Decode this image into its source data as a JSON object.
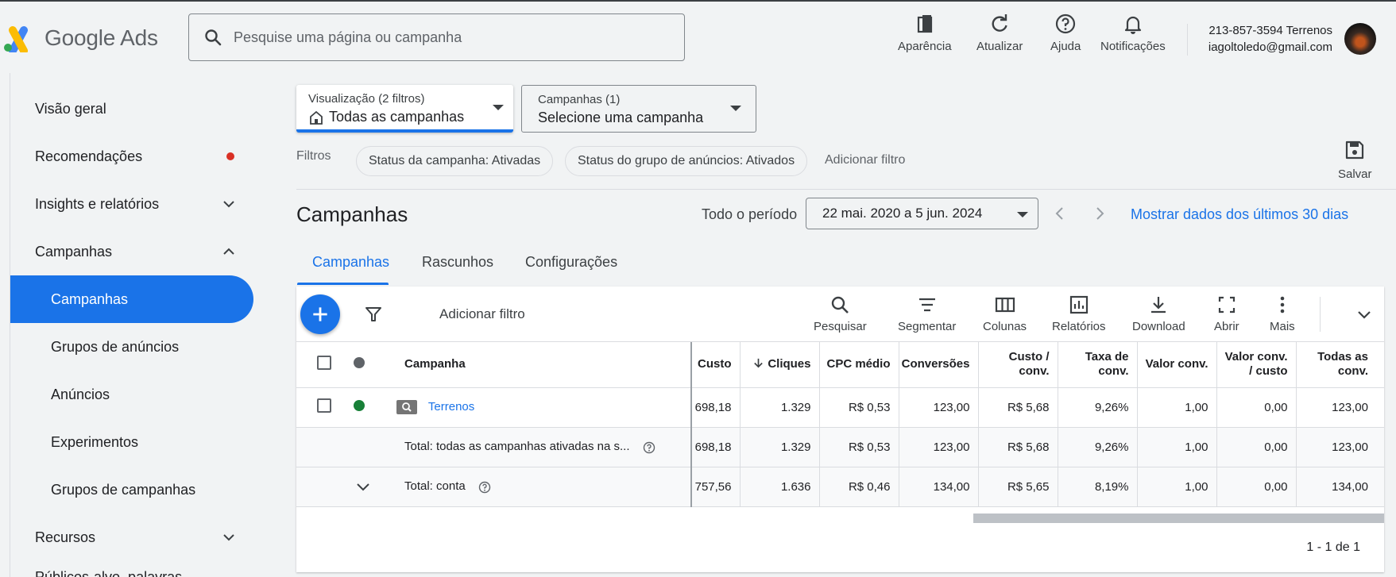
{
  "header": {
    "brand": "Google Ads",
    "search_placeholder": "Pesquise uma página ou campanha",
    "buttons": [
      {
        "label": "Aparência",
        "icon": "appearance-icon"
      },
      {
        "label": "Atualizar",
        "icon": "refresh-icon"
      },
      {
        "label": "Ajuda",
        "icon": "help-icon"
      },
      {
        "label": "Notificações",
        "icon": "bell-icon"
      }
    ],
    "account_line1": "213-857-3594 Terrenos",
    "account_line2": "iagoltoledo@gmail.com"
  },
  "sidebar": {
    "items": [
      {
        "label": "Visão geral"
      },
      {
        "label": "Recomendações"
      },
      {
        "label": "Insights e relatórios"
      },
      {
        "label": "Campanhas"
      },
      {
        "label": "Campanhas"
      },
      {
        "label": "Grupos de anúncios"
      },
      {
        "label": "Anúncios"
      },
      {
        "label": "Experimentos"
      },
      {
        "label": "Grupos de campanhas"
      },
      {
        "label": "Recursos"
      },
      {
        "label": "Públicos-alvo, palavras-"
      }
    ]
  },
  "view_select": {
    "small": "Visualização (2 filtros)",
    "value": "Todas as campanhas"
  },
  "campaign_select": {
    "small": "Campanhas (1)",
    "value": "Selecione uma campanha"
  },
  "filters": {
    "label": "Filtros",
    "chips": [
      "Status da campanha: Ativadas",
      "Status do grupo de anúncios: Ativados"
    ],
    "add": "Adicionar filtro",
    "save": "Salvar"
  },
  "page": {
    "title": "Campanhas",
    "period_label": "Todo o período",
    "date_range": "22 mai. 2020 a 5 jun. 2024",
    "last30": "Mostrar dados dos últimos 30 dias"
  },
  "tabs": [
    "Campanhas",
    "Rascunhos",
    "Configurações"
  ],
  "toolbar": {
    "add_filter": "Adicionar filtro",
    "buttons": [
      "Pesquisar",
      "Segmentar",
      "Colunas",
      "Relatórios",
      "Download",
      "Abrir",
      "Mais"
    ]
  },
  "table": {
    "headers": {
      "campaign": "Campanha",
      "cost": "Custo",
      "clicks": "Cliques",
      "cpc": "CPC médio",
      "conv": "Conversões",
      "cost_conv_1": "Custo /",
      "cost_conv_2": "conv.",
      "rate_1": "Taxa de",
      "rate_2": "conv.",
      "value": "Valor conv.",
      "value_cost_1": "Valor conv.",
      "value_cost_2": "/ custo",
      "all_1": "Todas as",
      "all_2": "conv."
    },
    "row": {
      "name": "Terrenos",
      "cost": "698,18",
      "clicks": "1.329",
      "cpc": "R$ 0,53",
      "conv": "123,00",
      "cost_conv": "R$ 5,68",
      "rate": "9,26%",
      "value": "1,00",
      "value_cost": "0,00",
      "all": "123,00"
    },
    "total_active": {
      "label": "Total: todas as campanhas ativadas na s...",
      "cost": "698,18",
      "clicks": "1.329",
      "cpc": "R$ 0,53",
      "conv": "123,00",
      "cost_conv": "R$ 5,68",
      "rate": "9,26%",
      "value": "1,00",
      "value_cost": "0,00",
      "all": "123,00"
    },
    "total_account": {
      "label": "Total: conta",
      "cost": "757,56",
      "clicks": "1.636",
      "cpc": "R$ 0,46",
      "conv": "134,00",
      "cost_conv": "R$ 5,65",
      "rate": "8,19%",
      "value": "1,00",
      "value_cost": "0,00",
      "all": "134,00"
    },
    "pager": "1 - 1 de 1"
  },
  "colors": {
    "accent": "#1a73e8",
    "active_status": "#188038",
    "alert_dot": "#d93025"
  }
}
